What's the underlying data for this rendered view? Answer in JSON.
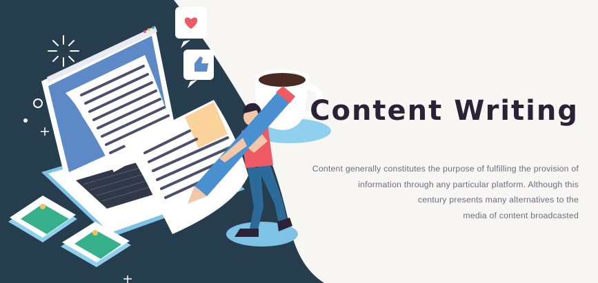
{
  "hero": {
    "title": "Content Writing",
    "description_lines": [
      "Content generally constitutes the purpose of fulfilling the provision of",
      "information through any particular platform. Although this",
      "century presents many alternatives to the",
      "media of content broadcasted"
    ]
  },
  "colors": {
    "page_background": "#f8f6f3",
    "dark_panel": "#263d4e",
    "title_text": "#2a2236",
    "body_text": "#6f6a7a",
    "accent_blue": "#6fb6e0",
    "accent_red": "#ef5b64",
    "accent_green": "#35b08b"
  },
  "icons": [
    "heart-icon",
    "thumbs-up-icon",
    "sparkle-icon",
    "image-card-icon",
    "coffee-cup-icon",
    "pencil-icon"
  ]
}
